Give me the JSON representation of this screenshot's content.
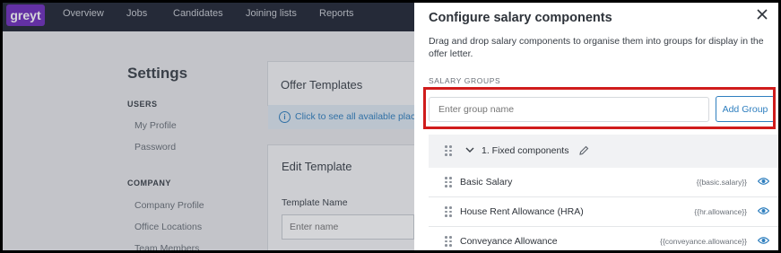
{
  "app": {
    "logo_text": "greyt"
  },
  "nav": {
    "items": [
      "Overview",
      "Jobs",
      "Candidates",
      "Joining lists",
      "Reports"
    ]
  },
  "settings": {
    "title": "Settings",
    "sections": [
      {
        "label": "USERS",
        "links": [
          "My Profile",
          "Password"
        ]
      },
      {
        "label": "COMPANY",
        "links": [
          "Company Profile",
          "Office Locations",
          "Team Members"
        ]
      }
    ]
  },
  "content": {
    "offer_templates_title": "Offer Templates",
    "info_text": "Click to see all available plac",
    "edit_template_title": "Edit Template",
    "template_name_label": "Template Name",
    "template_name_placeholder": "Enter name"
  },
  "drawer": {
    "title": "Configure salary components",
    "description": "Drag and drop salary components to organise them into groups for display in the offer letter.",
    "section_label": "SALARY GROUPS",
    "group_input_placeholder": "Enter group name",
    "add_group_label": "Add Group",
    "group": {
      "title": "1. Fixed components",
      "components": [
        {
          "label": "Basic Salary",
          "variable": "{{basic.salary}}"
        },
        {
          "label": "House Rent Allowance (HRA)",
          "variable": "{{hr.allowance}}"
        },
        {
          "label": "Conveyance Allowance",
          "variable": "{{conveyance.allowance}}"
        }
      ]
    }
  },
  "colors": {
    "accent": "#2f7fbf",
    "nav_bg": "#1f2532",
    "logo_bg": "#6f2dbd",
    "highlight": "#d01c1c"
  }
}
